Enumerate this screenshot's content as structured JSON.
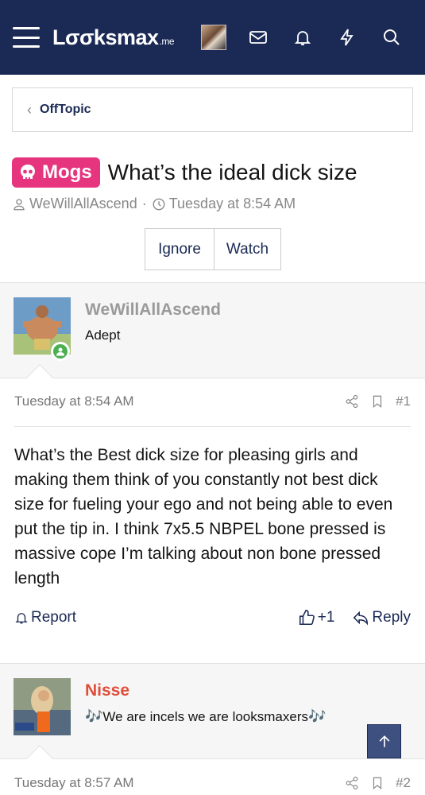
{
  "header": {
    "logo_main": "Lσσksmax",
    "logo_suffix": ".me",
    "icons": [
      "menu-icon",
      "user-avatar",
      "mail-icon",
      "bell-icon",
      "bolt-icon",
      "search-icon"
    ]
  },
  "breadcrumb": {
    "label": "OffTopic"
  },
  "thread": {
    "prefix": "Mogs",
    "title": "What’s the ideal dick size",
    "author": "WeWillAllAscend",
    "separator": "·",
    "date": "Tuesday at 8:54 AM",
    "buttons": {
      "ignore": "Ignore",
      "watch": "Watch"
    }
  },
  "posts": [
    {
      "username": "WeWillAllAscend",
      "user_title": "Adept",
      "date": "Tuesday at 8:54 AM",
      "number": "#1",
      "body": "What’s the Best dick size for pleasing girls and making them think of you constantly not best dick size for fueling your ego and not being able to even put the tip in. I think 7x5.5 NBPEL bone pressed is massive cope I’m talking about non bone pressed length",
      "report_label": "Report",
      "reaction_count": "+1",
      "reply_label": "Reply"
    },
    {
      "username": "Nisse",
      "user_title": "We are incels we are looksmaxers",
      "note_glyph": "🎶",
      "date": "Tuesday at 8:57 AM",
      "number": "#2"
    }
  ],
  "colors": {
    "header_bg": "#1b2a55",
    "prefix_bg": "#e6347f",
    "username2": "#e04e3a",
    "online": "#4caf50"
  }
}
